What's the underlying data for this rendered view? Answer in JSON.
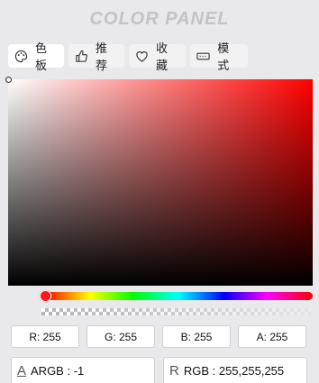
{
  "title": "COLOR PANEL",
  "tabs": [
    {
      "label": "色板",
      "icon": "palette-icon",
      "active": true
    },
    {
      "label": "推荐",
      "icon": "thumbs-up-icon",
      "active": false
    },
    {
      "label": "收藏",
      "icon": "heart-icon",
      "active": false
    },
    {
      "label": "模式",
      "icon": "keyboard-icon",
      "active": false
    }
  ],
  "color": {
    "hex": "#FF0000",
    "hue_fraction": 0.0,
    "alpha_fraction": 1.0
  },
  "channels": [
    {
      "text": "R: 255"
    },
    {
      "text": "G: 255"
    },
    {
      "text": "B: 255"
    },
    {
      "text": "A: 255"
    }
  ],
  "formats": {
    "argb": {
      "lead": "A",
      "text": "ARGB : -1"
    },
    "rgb": {
      "lead": "R",
      "text": "RGB : 255,255,255"
    }
  }
}
